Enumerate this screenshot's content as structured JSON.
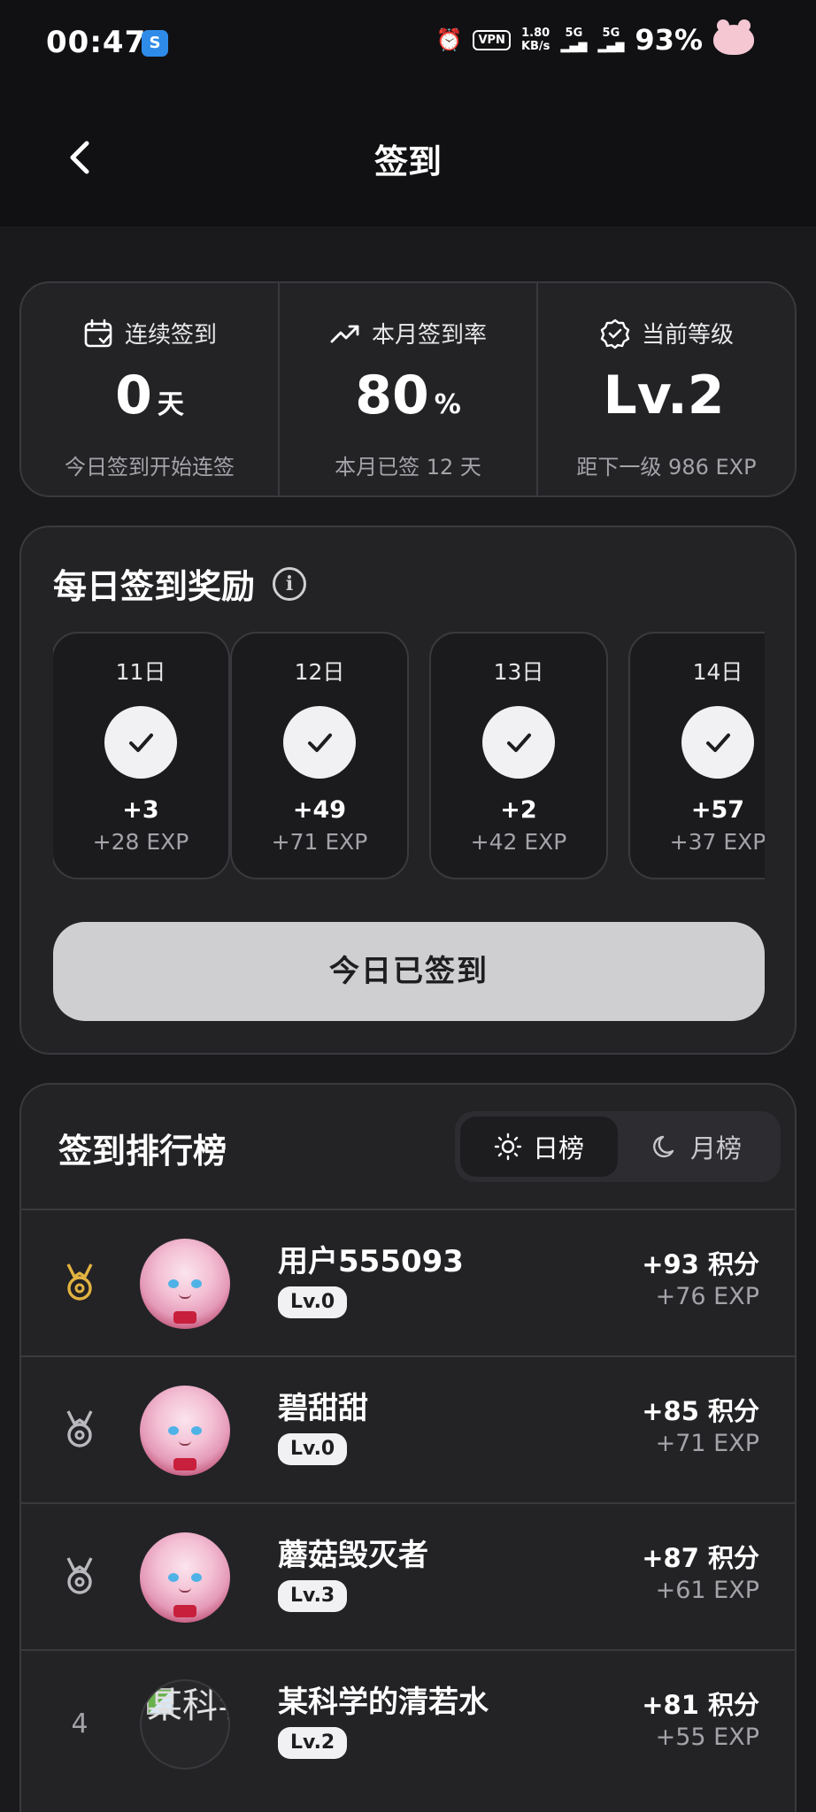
{
  "status_bar": {
    "time": "00:47",
    "app_icon": "S",
    "net_speed_value": "1.80",
    "net_speed_unit": "KB/s",
    "vpn": "VPN",
    "sim1": "5G",
    "sim2": "5G",
    "battery": "93%"
  },
  "header": {
    "title": "签到"
  },
  "stats": [
    {
      "icon": "calendar-check-icon",
      "label": "连续签到",
      "value": "0",
      "unit": "天",
      "sub": "今日签到开始连签"
    },
    {
      "icon": "trending-up-icon",
      "label": "本月签到率",
      "value": "80",
      "unit": "%",
      "sub": "本月已签 12 天"
    },
    {
      "icon": "badge-check-icon",
      "label": "当前等级",
      "value": "Lv.2",
      "unit": "",
      "sub": "距下一级 986 EXP"
    }
  ],
  "rewards": {
    "title": "每日签到奖励",
    "days": [
      {
        "label": "11日",
        "points": "+3",
        "exp": "+28 EXP"
      },
      {
        "label": "12日",
        "points": "+49",
        "exp": "+71 EXP"
      },
      {
        "label": "13日",
        "points": "+2",
        "exp": "+42 EXP"
      },
      {
        "label": "14日",
        "points": "+57",
        "exp": "+37 EXP"
      }
    ],
    "button_label": "今日已签到"
  },
  "ranking": {
    "title": "签到排行榜",
    "tabs": [
      {
        "label": "日榜",
        "icon": "sun-icon",
        "active": true
      },
      {
        "label": "月榜",
        "icon": "moon-icon",
        "active": false
      }
    ],
    "rows": [
      {
        "rank": "1",
        "medal": "gold-medal-icon",
        "name": "用户555093",
        "level": "Lv.0",
        "points": "+93 积分",
        "exp": "+76 EXP"
      },
      {
        "rank": "2",
        "medal": "silver-medal-icon",
        "name": "碧甜甜",
        "level": "Lv.0",
        "points": "+85 积分",
        "exp": "+71 EXP"
      },
      {
        "rank": "3",
        "medal": "bronze-medal-icon",
        "name": "蘑菇毁灭者",
        "level": "Lv.3",
        "points": "+87 积分",
        "exp": "+61 EXP"
      },
      {
        "rank": "4",
        "medal": "",
        "name": "某科学的清若水",
        "level": "Lv.2",
        "points": "+81 积分",
        "exp": "+55 EXP",
        "avatar_alt": "某科学"
      }
    ]
  },
  "colors": {
    "background": "#1a1a1c",
    "card": "#232326",
    "gold": "#e3b341",
    "silver": "#b9b9bd"
  }
}
